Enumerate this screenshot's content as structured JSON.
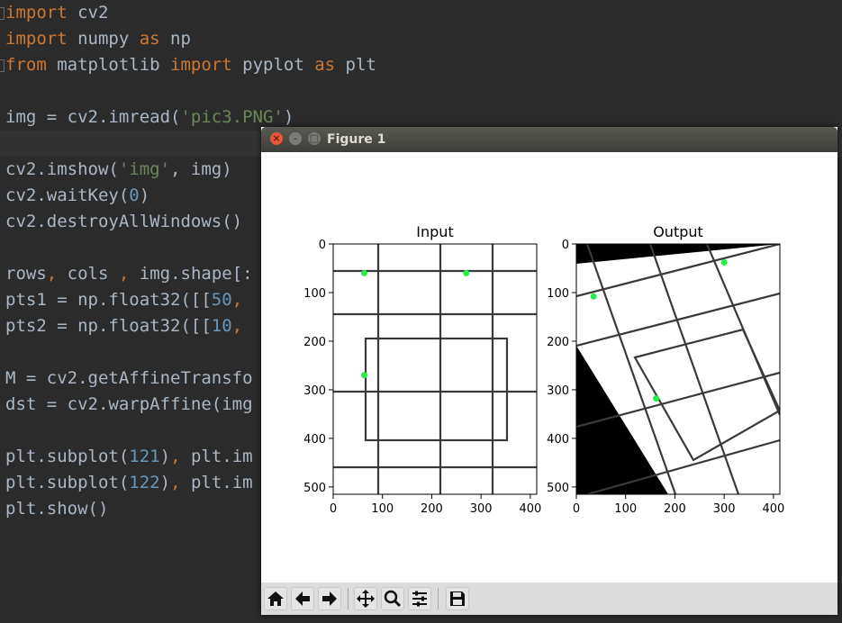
{
  "editor": {
    "lines": [
      [
        [
          "import",
          "kw"
        ],
        [
          " cv2",
          ""
        ]
      ],
      [
        [
          "import",
          "kw"
        ],
        [
          " numpy ",
          ""
        ],
        [
          "as",
          "kw"
        ],
        [
          " np",
          ""
        ]
      ],
      [
        [
          "from",
          "kw"
        ],
        [
          " matplotlib ",
          ""
        ],
        [
          "import",
          "kw"
        ],
        [
          " pyplot ",
          ""
        ],
        [
          "as",
          "kw"
        ],
        [
          " plt",
          ""
        ]
      ],
      [],
      [
        [
          "img = cv2.imread(",
          ""
        ],
        [
          "'pic3.PNG'",
          "str"
        ],
        [
          ")",
          ""
        ]
      ],
      [],
      [
        [
          "cv2.imshow(",
          ""
        ],
        [
          "'img'",
          "str"
        ],
        [
          ", img)",
          ""
        ]
      ],
      [
        [
          "cv2.waitKey(",
          ""
        ],
        [
          "0",
          "num"
        ],
        [
          ")",
          ""
        ]
      ],
      [
        [
          "cv2.destroyAllWindows()",
          ""
        ]
      ],
      [],
      [
        [
          "rows",
          ""
        ],
        [
          ",",
          "kw"
        ],
        [
          " cols ",
          ""
        ],
        [
          ",",
          "kw"
        ],
        [
          " img.shape[:",
          ""
        ]
      ],
      [
        [
          "pts1 = np.float32([[",
          ""
        ],
        [
          "50",
          "num"
        ],
        [
          ",",
          "kw"
        ]
      ],
      [
        [
          "pts2 = np.float32([[",
          ""
        ],
        [
          "10",
          "num"
        ],
        [
          ",",
          "kw"
        ]
      ],
      [],
      [
        [
          "M = cv2.getAffineTransfo",
          ""
        ]
      ],
      [
        [
          "dst = cv2.warpAffine(img",
          ""
        ]
      ],
      [],
      [
        [
          "plt.subplot(",
          ""
        ],
        [
          "121",
          "num"
        ],
        [
          ")",
          ""
        ],
        [
          ",",
          "kw"
        ],
        [
          " plt.im",
          ""
        ]
      ],
      [
        [
          "plt.subplot(",
          ""
        ],
        [
          "122",
          "num"
        ],
        [
          ")",
          ""
        ],
        [
          ",",
          "kw"
        ],
        [
          " plt.im",
          ""
        ]
      ],
      [
        [
          "plt.show()",
          ""
        ]
      ]
    ]
  },
  "window": {
    "title": "Figure 1",
    "close_glyph": "×",
    "min_glyph": "–",
    "max_glyph": "□"
  },
  "chart_data": [
    {
      "type": "image",
      "title": "Input",
      "xlim": [
        0,
        413
      ],
      "ylim": [
        515,
        0
      ],
      "xticks": [
        0,
        100,
        200,
        300,
        400
      ],
      "yticks": [
        0,
        100,
        200,
        300,
        400,
        500
      ],
      "green_points": [
        [
          63,
          60
        ],
        [
          270,
          60
        ],
        [
          63,
          270
        ]
      ]
    },
    {
      "type": "image",
      "title": "Output",
      "xlim": [
        0,
        413
      ],
      "ylim": [
        515,
        0
      ],
      "xticks": [
        0,
        100,
        200,
        300,
        400
      ],
      "yticks": [
        0,
        100,
        200,
        300,
        400,
        500
      ],
      "green_points": [
        [
          35,
          108
        ],
        [
          300,
          38
        ],
        [
          162,
          318
        ]
      ]
    }
  ],
  "toolbar": {
    "buttons": [
      "home-icon",
      "back-arrow-icon",
      "forward-arrow-icon",
      "pan-icon",
      "zoom-icon",
      "configure-subplots-icon",
      "save-icon"
    ]
  },
  "colors": {
    "editor_bg": "#2b2b2b",
    "keyword": "#cc7832",
    "string": "#6a8759",
    "number": "#6897bb",
    "text": "#a9b7c6",
    "marker": "#22ee44"
  }
}
